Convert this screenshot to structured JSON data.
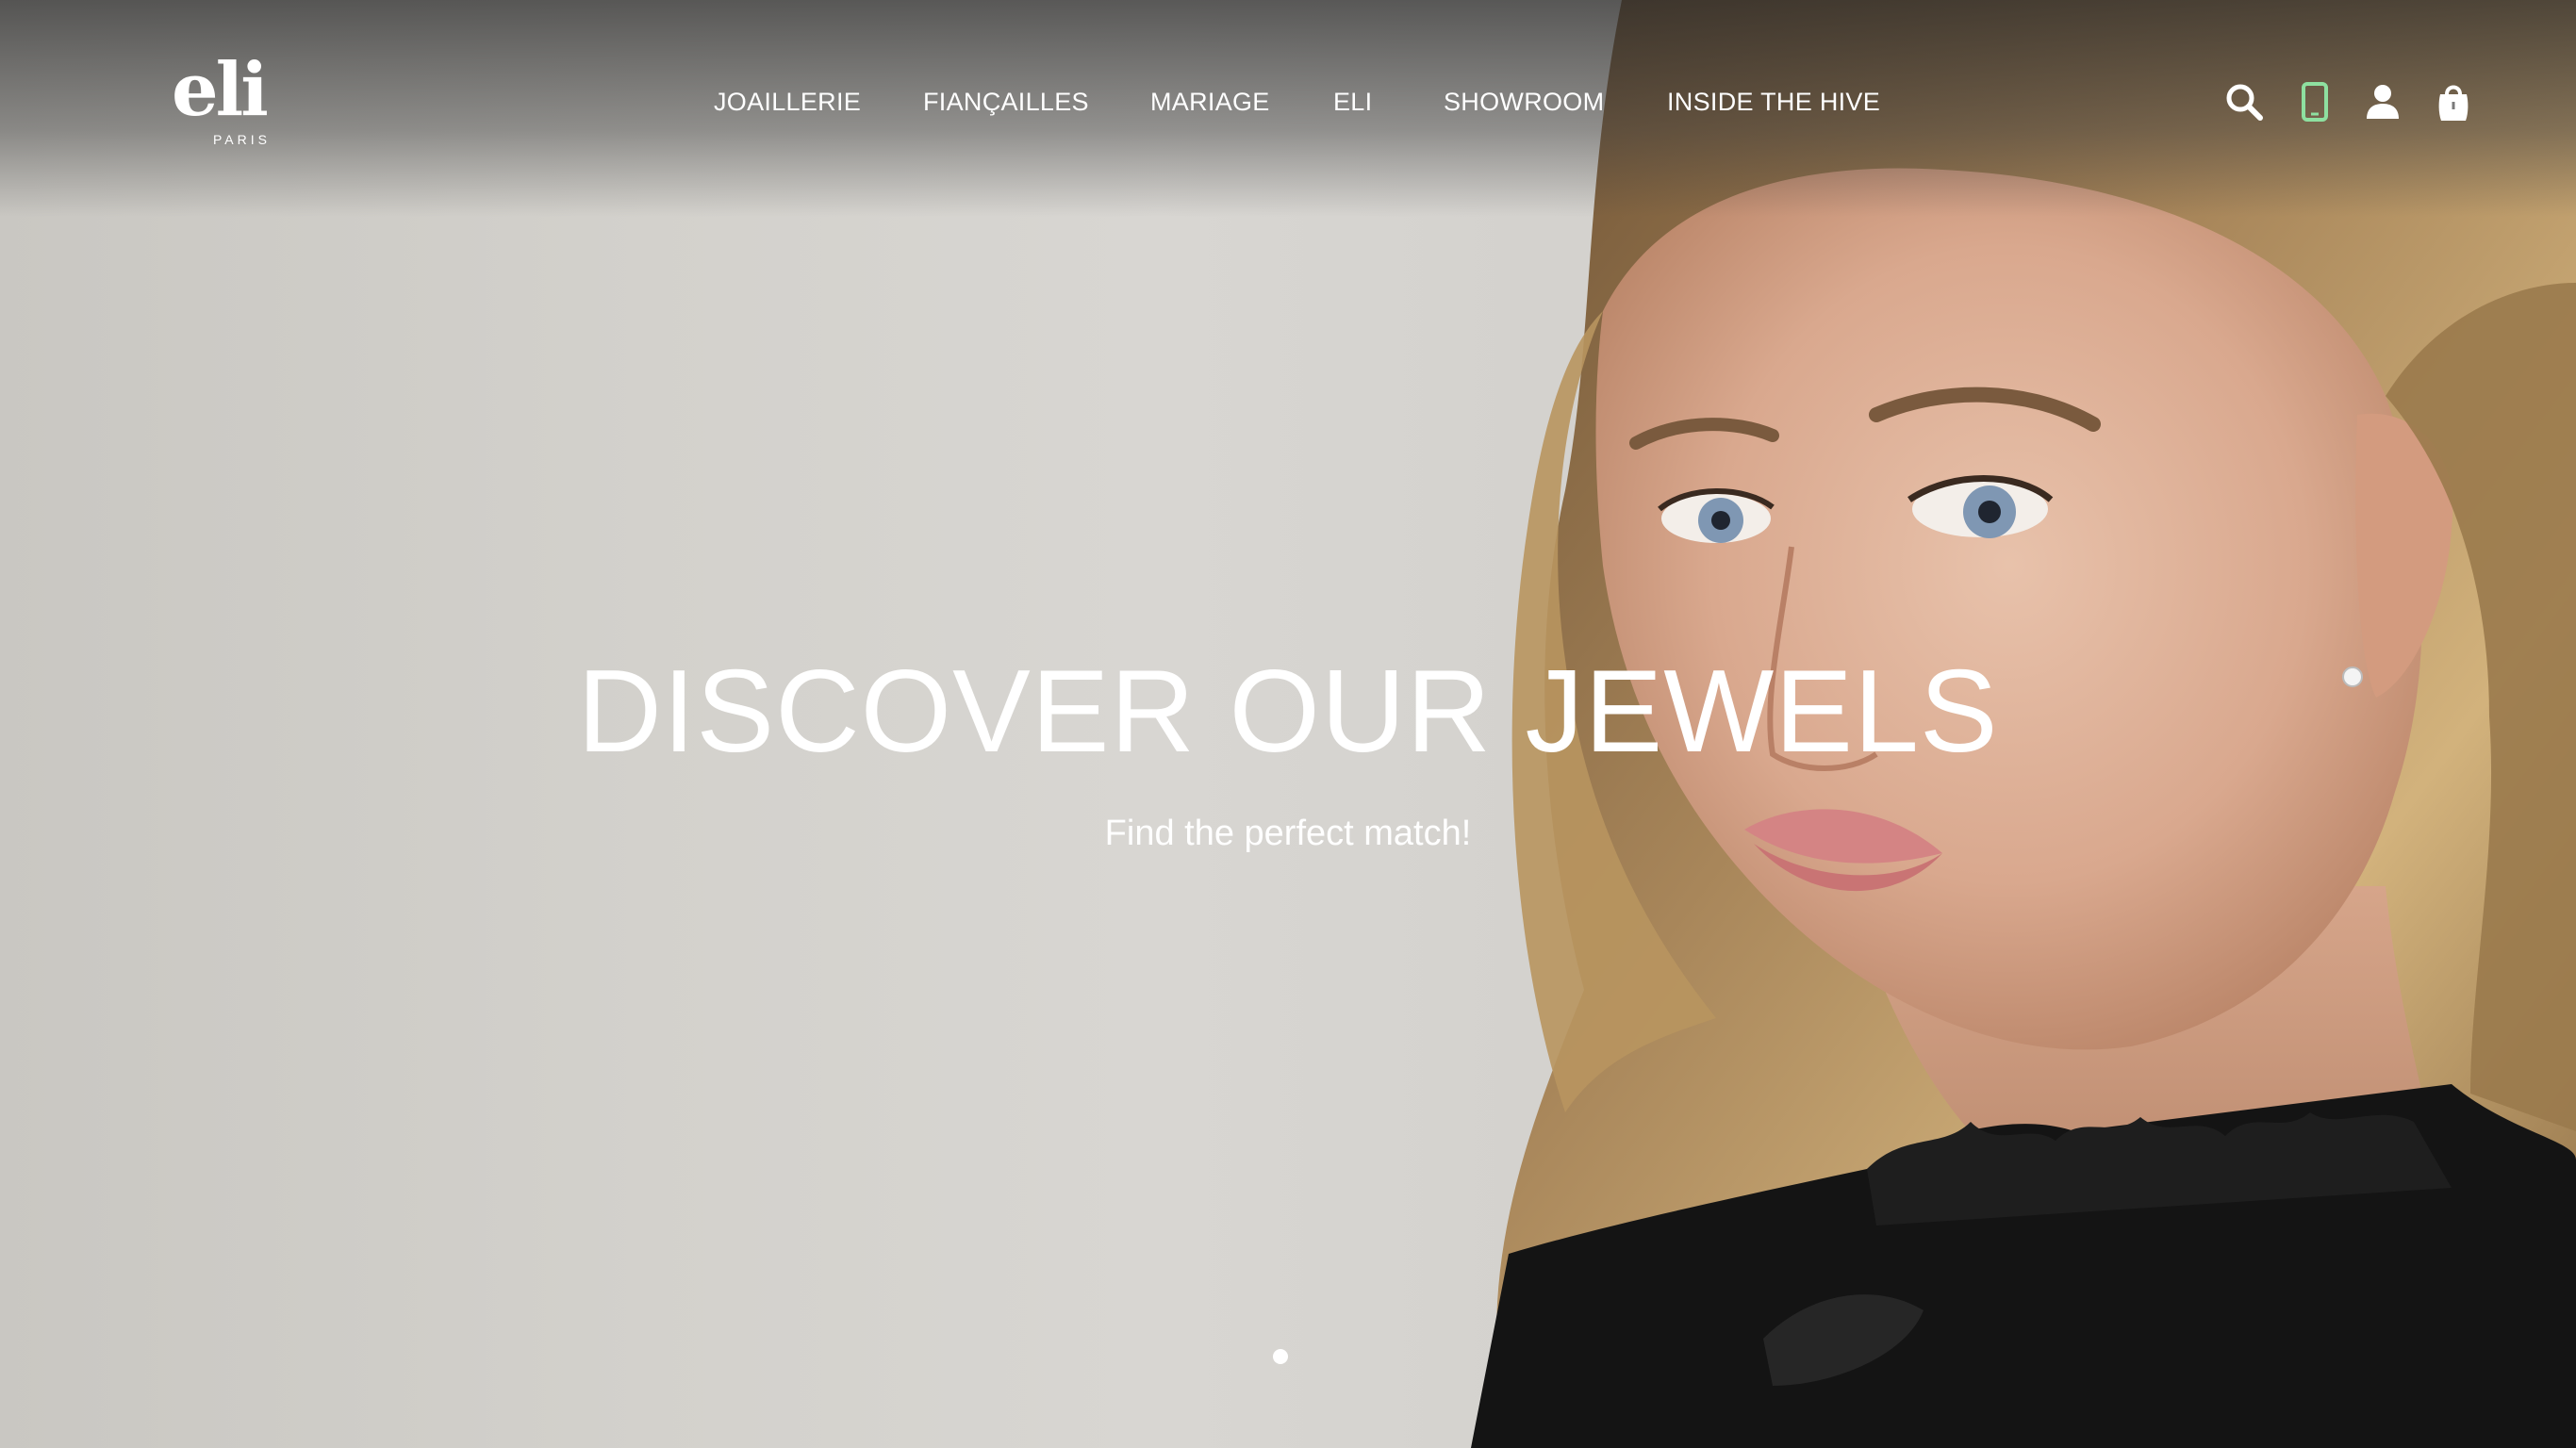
{
  "brand": {
    "name": "eli",
    "sub": "PARIS"
  },
  "nav": {
    "items": [
      {
        "label": "JOAILLERIE"
      },
      {
        "label": "FIANÇAILLES"
      },
      {
        "label": "MARIAGE"
      },
      {
        "label": "ELI"
      },
      {
        "label": "SHOWROOM"
      },
      {
        "label": "INSIDE THE HIVE"
      }
    ]
  },
  "header_icons": {
    "search": "search-icon",
    "phone": "phone-icon",
    "account": "user-icon",
    "cart": "shopping-bag-icon"
  },
  "hero": {
    "title": "DISCOVER OUR JEWELS",
    "subtitle": "Find the perfect match!"
  },
  "carousel": {
    "current_slide": 1,
    "total_slides": 1
  },
  "colors": {
    "text": "#ffffff",
    "phone_accent": "#8ee0a0"
  }
}
